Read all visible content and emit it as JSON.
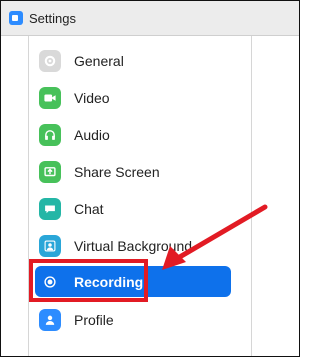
{
  "window": {
    "title": "Settings"
  },
  "sidebar": {
    "items": [
      {
        "label": "General",
        "icon": "gear-icon",
        "color": "#d7d7d7"
      },
      {
        "label": "Video",
        "icon": "video-camera-icon",
        "color": "#47c15a"
      },
      {
        "label": "Audio",
        "icon": "headphones-icon",
        "color": "#47c15a"
      },
      {
        "label": "Share Screen",
        "icon": "share-screen-icon",
        "color": "#47c15a"
      },
      {
        "label": "Chat",
        "icon": "chat-bubble-icon",
        "color": "#24b6a6"
      },
      {
        "label": "Virtual Background",
        "icon": "person-frame-icon",
        "color": "#2aa6d8"
      },
      {
        "label": "Recording",
        "icon": "record-icon",
        "active": true,
        "color": "#0e71eb"
      },
      {
        "label": "Profile",
        "icon": "profile-icon",
        "color": "#2d8cff"
      }
    ]
  },
  "annotation": {
    "highlight_color": "#e21b24"
  }
}
